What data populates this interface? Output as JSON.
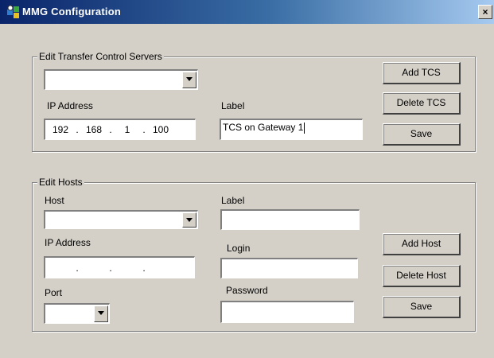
{
  "window": {
    "title": "MMG Configuration",
    "close_glyph": "×"
  },
  "tcs_group": {
    "legend": "Edit Transfer Control Servers",
    "server_select_value": "",
    "ip_label": "IP Address",
    "ip_octets": [
      "192",
      "168",
      "1",
      "100"
    ],
    "ip_separator": ".",
    "label_label": "Label",
    "label_value": "TCS on Gateway 1",
    "add_button": "Add TCS",
    "delete_button": "Delete TCS",
    "save_button": "Save"
  },
  "hosts_group": {
    "legend": "Edit Hosts",
    "host_label": "Host",
    "host_select_value": "",
    "ip_label": "IP Address",
    "ip_octets": [
      "",
      "",
      "",
      ""
    ],
    "ip_separator": ".",
    "port_label": "Port",
    "port_select_value": "",
    "label_label": "Label",
    "label_value": "",
    "login_label": "Login",
    "login_value": "",
    "password_label": "Password",
    "password_value": "",
    "add_button": "Add Host",
    "delete_button": "Delete Host",
    "save_button": "Save"
  },
  "icons": {
    "app": "mmg-app-icon",
    "dropdown": "chevron-down-icon"
  }
}
